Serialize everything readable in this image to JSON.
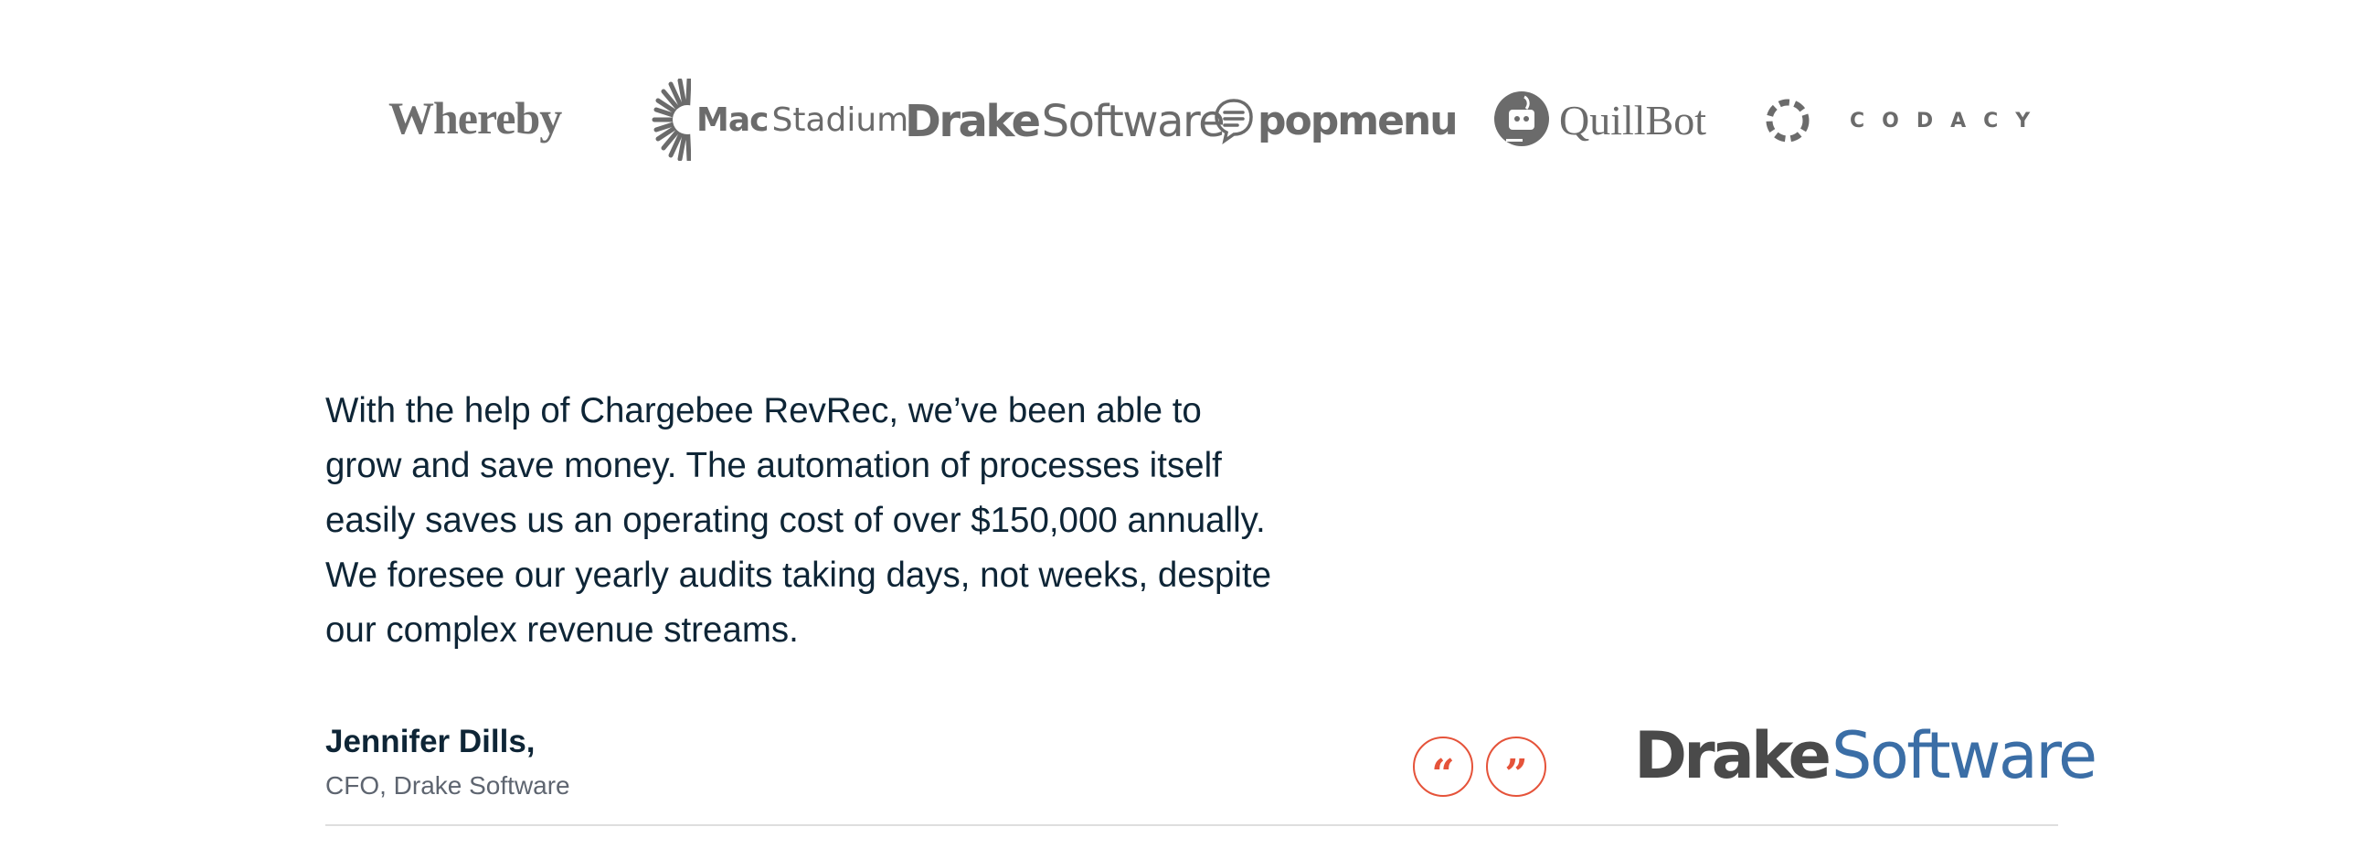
{
  "logos": {
    "whereby": "Whereby",
    "macstadium": {
      "mac": "Mac",
      "stadium": "Stadium"
    },
    "drake_small": {
      "drake": "Drake",
      "software": "Software"
    },
    "popmenu": "popmenu",
    "quillbot": "QuillBot",
    "codacy": "CODACY"
  },
  "testimonial": {
    "quote": "With the help of Chargebee RevRec, we’ve been able to grow and save money. The automation of processes itself easily saves us an operating cost of over $150,000 annually. We foresee our yearly audits taking days, not weeks, despite our complex revenue streams.",
    "author_name": "Jennifer Dills,",
    "author_role": "CFO, Drake Software",
    "company_logo": {
      "drake": "Drake",
      "software": "Software"
    }
  },
  "nav": {
    "prev_label": "“",
    "next_label": "”"
  },
  "colors": {
    "accent": "#e5533a",
    "text_dark": "#0e2536",
    "text_muted": "#5e6570",
    "logo_gray": "#6b6b6b",
    "drake_blue": "#3b6ea6"
  }
}
